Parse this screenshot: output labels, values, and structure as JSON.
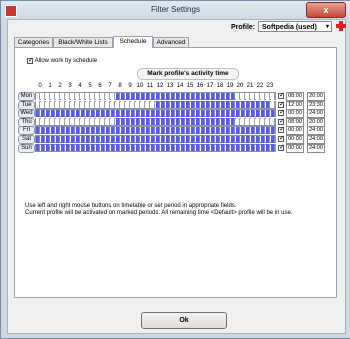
{
  "window": {
    "title": "Filter Settings",
    "close_label": "x"
  },
  "profile": {
    "label": "Profile:",
    "value": "Softpedia (used)",
    "arrow": "▾",
    "add_icon": "plus-icon"
  },
  "tabs": [
    {
      "label": "Categories"
    },
    {
      "label": "Black/White Lists"
    },
    {
      "label": "Schedule"
    },
    {
      "label": "Advanced"
    }
  ],
  "schedule": {
    "allow_label": "Allow work by schedule",
    "allow_checked": true,
    "mark_title": "Mark profile's activity time",
    "hours": [
      "0",
      "1",
      "2",
      "3",
      "4",
      "5",
      "6",
      "7",
      "8",
      "9",
      "10",
      "11",
      "12",
      "13",
      "14",
      "15",
      "16",
      "17",
      "18",
      "19",
      "20",
      "21",
      "22",
      "23"
    ],
    "days": [
      {
        "name": "Mon",
        "from": "08:00",
        "to": "20:00",
        "enabled": true,
        "start": 8,
        "end": 20
      },
      {
        "name": "Tue",
        "from": "12:00",
        "to": "23:30",
        "enabled": true,
        "start": 12,
        "end": 23.5
      },
      {
        "name": "Wed",
        "from": "00:00",
        "to": "24:00",
        "enabled": true,
        "start": 0,
        "end": 24
      },
      {
        "name": "Thu",
        "from": "08:00",
        "to": "20:00",
        "enabled": true,
        "start": 8,
        "end": 20
      },
      {
        "name": "Fri",
        "from": "00:00",
        "to": "24:00",
        "enabled": true,
        "start": 0,
        "end": 24
      },
      {
        "name": "Sat",
        "from": "00:00",
        "to": "24:00",
        "enabled": true,
        "start": 0,
        "end": 24
      },
      {
        "name": "Sun",
        "from": "00:00",
        "to": "24:00",
        "enabled": true,
        "start": 0,
        "end": 24
      }
    ],
    "info_line1": "Use left and right mouse buttons on timetable or set period in appropriate fields.",
    "info_line2": "Current profile will be activated on marked periods. All remaining time <Default> profile will be in use.",
    "active_color": "#5a5ae6"
  },
  "ok_label": "Ok"
}
